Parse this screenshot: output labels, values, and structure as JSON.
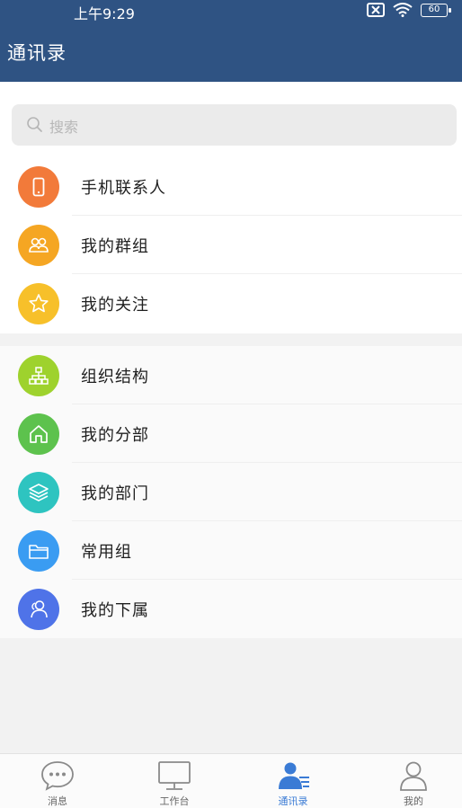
{
  "status_bar": {
    "time": "上午9:29",
    "battery": "60"
  },
  "header": {
    "title": "通讯录"
  },
  "search": {
    "placeholder": "搜索"
  },
  "group1": [
    {
      "label": "手机联系人",
      "icon": "phone-icon",
      "color": "#f27a3a"
    },
    {
      "label": "我的群组",
      "icon": "people-icon",
      "color": "#f5a623"
    },
    {
      "label": "我的关注",
      "icon": "star-icon",
      "color": "#f7c02a"
    }
  ],
  "group2": [
    {
      "label": "组织结构",
      "icon": "org-chart-icon",
      "color": "#9ed22d"
    },
    {
      "label": "我的分部",
      "icon": "home-icon",
      "color": "#5dc24d"
    },
    {
      "label": "我的部门",
      "icon": "layers-icon",
      "color": "#2ec4c0"
    },
    {
      "label": "常用组",
      "icon": "folder-icon",
      "color": "#3a9cf2"
    },
    {
      "label": "我的下属",
      "icon": "subordinate-icon",
      "color": "#4f73e8"
    }
  ],
  "tabs": [
    {
      "label": "消息",
      "icon": "message-icon",
      "active": false
    },
    {
      "label": "工作台",
      "icon": "workbench-icon",
      "active": false
    },
    {
      "label": "通讯录",
      "icon": "contacts-icon",
      "active": true
    },
    {
      "label": "我的",
      "icon": "profile-icon",
      "active": false
    }
  ],
  "colors": {
    "header": "#2f5383",
    "active_tab": "#3a7bd5"
  }
}
